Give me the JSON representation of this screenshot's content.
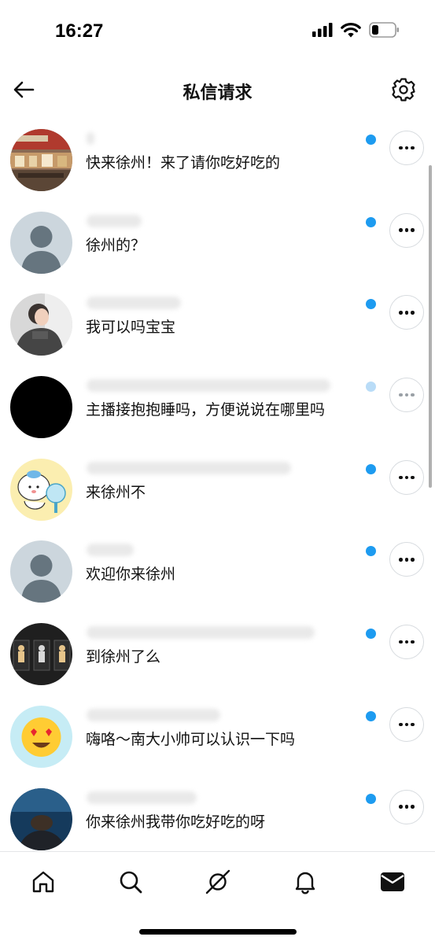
{
  "status_bar": {
    "time": "16:27"
  },
  "header": {
    "title": "私信请求",
    "back_icon": "arrow-left-icon",
    "settings_icon": "gear-icon"
  },
  "requests": [
    {
      "message": "快来徐州！来了请你吃好吃的",
      "unread": true
    },
    {
      "message": "徐州的？",
      "unread": true
    },
    {
      "message": "我可以吗宝宝",
      "unread": true
    },
    {
      "message": "主播接抱抱睡吗，方便说说在哪里吗",
      "unread": true
    },
    {
      "message": "来徐州不",
      "unread": true
    },
    {
      "message": "欢迎你来徐州",
      "unread": true
    },
    {
      "message": "到徐州了么",
      "unread": true
    },
    {
      "message": "嗨咯～南大小帅可以认识一下吗",
      "unread": true
    },
    {
      "message": "你来徐州我带你吃好吃的呀",
      "unread": true
    }
  ],
  "tabbar": {
    "items": [
      {
        "icon": "home-icon"
      },
      {
        "icon": "search-icon"
      },
      {
        "icon": "spaces-icon"
      },
      {
        "icon": "bell-icon"
      },
      {
        "icon": "mail-icon"
      }
    ]
  },
  "colors": {
    "accent": "#1d9bf0",
    "border": "#d7dbdf",
    "text": "#111111"
  }
}
